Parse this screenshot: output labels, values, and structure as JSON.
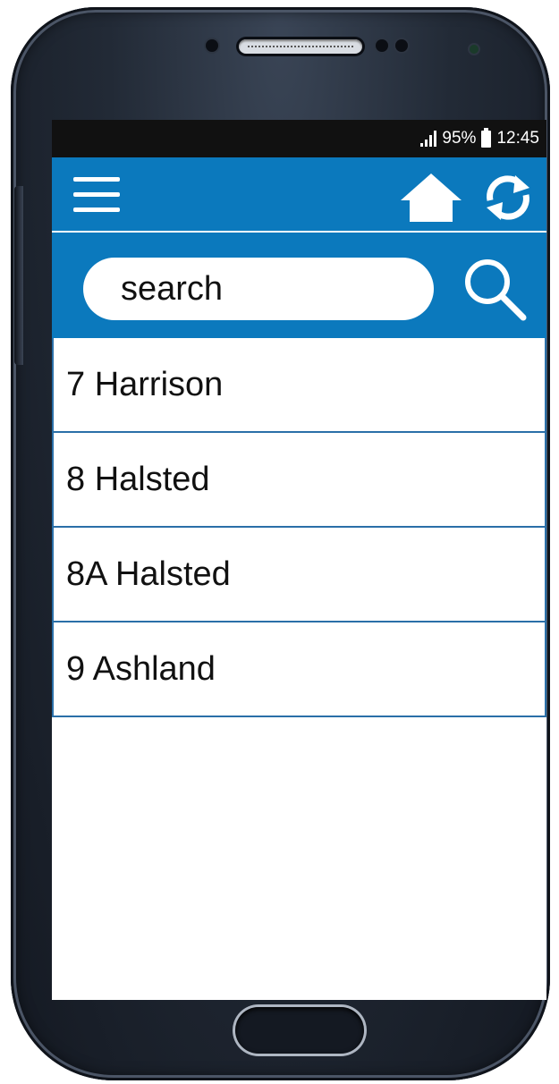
{
  "status_bar": {
    "battery": "95%",
    "time": "12:45"
  },
  "search": {
    "placeholder": "search"
  },
  "routes": [
    {
      "label": "7 Harrison"
    },
    {
      "label": "8 Halsted"
    },
    {
      "label": "8A Halsted"
    },
    {
      "label": "9 Ashland"
    }
  ],
  "icons": {
    "menu": "hamburger-menu-icon",
    "home": "home-icon",
    "refresh": "refresh-icon",
    "search": "search-icon"
  },
  "colors": {
    "accent": "#0b79bd",
    "row_border": "#2a6fa8",
    "status_bar": "#111111"
  }
}
